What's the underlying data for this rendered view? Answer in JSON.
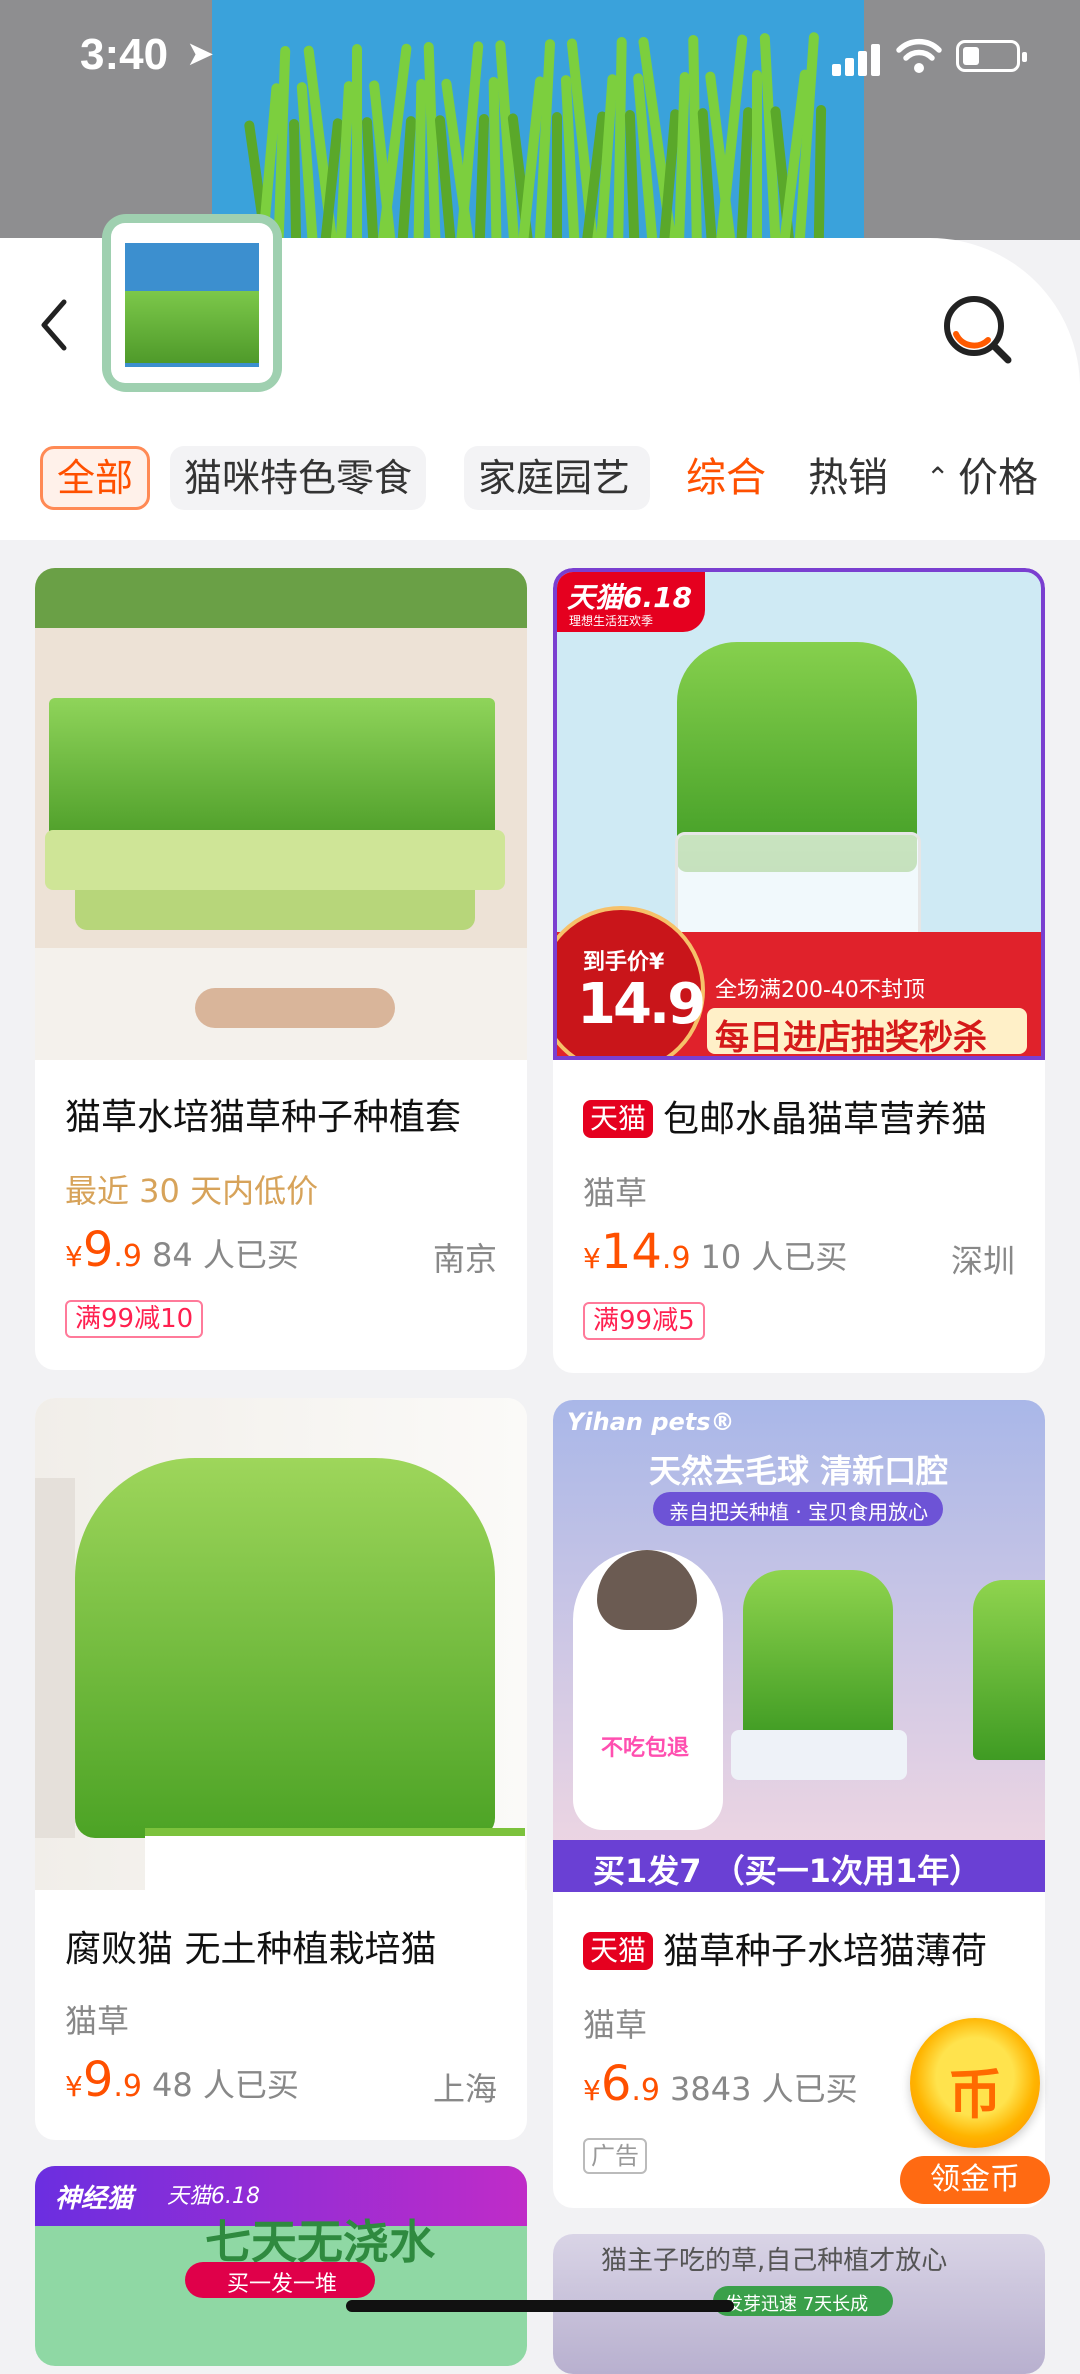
{
  "status_bar": {
    "time": "3:40",
    "location_glyph": "➤"
  },
  "header": {
    "back_icon": "chevron-left-icon",
    "camera_search_icon": "camera-search-icon"
  },
  "filters": {
    "chips": [
      "全部",
      "猫咪特色零食",
      "家庭园艺"
    ],
    "sort": [
      "综合",
      "热销",
      "价格"
    ],
    "sort_arrow_glyph": "⌃⌄"
  },
  "products": [
    {
      "title": "猫草水培猫草种子种植套",
      "tmall_badge": "",
      "subtitle": "最近 30 天内低价",
      "price_symbol": "¥",
      "price_int": "9",
      "price_dec": ".9",
      "sold": "84 人已买",
      "city": "南京",
      "promo": "满99减10"
    },
    {
      "title": "包邮水晶猫草营养猫",
      "tmall_badge": "天猫",
      "subtitle": "猫草",
      "price_symbol": "¥",
      "price_int": "14",
      "price_dec": ".9",
      "sold": "10 人已买",
      "city": "深圳",
      "promo": "满99减5",
      "image_text": {
        "event": "天猫6.18",
        "event_sub": "理想生活狂欢季",
        "hand_price_label": "到手价¥",
        "hand_price": "14.9",
        "banner_top": "全场满200-40不封顶",
        "banner_main": "每日进店抽奖秒杀"
      }
    },
    {
      "title": "腐败猫  无土种植栽培猫",
      "tmall_badge": "",
      "subtitle": "猫草",
      "price_symbol": "¥",
      "price_int": "9",
      "price_dec": ".9",
      "sold": "48 人已买",
      "city": "上海"
    },
    {
      "title": "猫草种子水培猫薄荷",
      "tmall_badge": "天猫",
      "subtitle": "猫草",
      "price_symbol": "¥",
      "price_int": "6",
      "price_dec": ".9",
      "sold": "3843 人已买",
      "ad_label": "广告",
      "image_text": {
        "brand": "Yihan pets®",
        "headline": "天然去毛球  清新口腔",
        "sub": "亲自把关种植 · 宝贝食用放心",
        "cat_tag": "不吃包退",
        "banner": "买1发7  （买一1次用1年）"
      }
    },
    {
      "image_text": {
        "brand": "神经猫",
        "event": "天猫6.18",
        "headline": "七天无浇水",
        "sub": "买一发一堆"
      }
    },
    {
      "image_text": {
        "headline": "猫主子吃的草,自己种植才放心",
        "sub": "发芽迅速 7天长成"
      }
    }
  ],
  "coin_widget": {
    "symbol": "币",
    "label": "领金币"
  },
  "colors": {
    "accent": "#ff5000",
    "tmall_red": "#e5001f"
  }
}
